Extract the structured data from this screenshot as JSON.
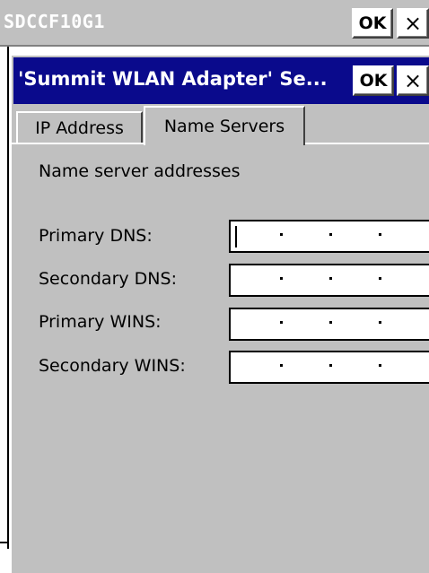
{
  "outer_window": {
    "title": "SDCCF10G1",
    "ok_label": "OK",
    "close_label": "×"
  },
  "dialog": {
    "title": "'Summit WLAN Adapter' Se...",
    "ok_label": "OK",
    "close_label": "×"
  },
  "tabs": [
    {
      "label": "IP Address",
      "active": false
    },
    {
      "label": "Name Servers",
      "active": true
    }
  ],
  "panel": {
    "heading": "Name server addresses",
    "fields": [
      {
        "label": "Primary DNS:",
        "value": "",
        "focused": true
      },
      {
        "label": "Secondary DNS:",
        "value": ""
      },
      {
        "label": "Primary WINS:",
        "value": ""
      },
      {
        "label": "Secondary WINS:",
        "value": ""
      }
    ]
  },
  "colors": {
    "active_title_bg": "#0a0a8c",
    "inactive_title_bg": "#c0c0c0",
    "face": "#c0c0c0"
  }
}
